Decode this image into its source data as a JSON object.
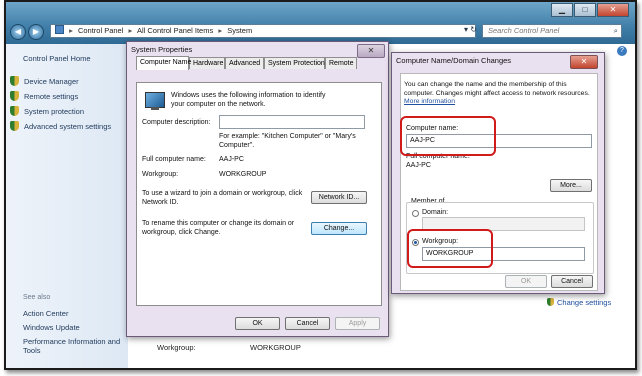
{
  "window": {
    "controls": {
      "minimize": "▁",
      "maximize": "□",
      "close": "✕"
    },
    "address": {
      "root_icon": "control-panel-icon",
      "crumbs": [
        "Control Panel",
        "All Control Panel Items",
        "System"
      ]
    },
    "search_placeholder": "Search Control Panel"
  },
  "sidebar": {
    "home": "Control Panel Home",
    "items": [
      "Device Manager",
      "Remote settings",
      "System protection",
      "Advanced system settings"
    ],
    "see_also": "See also",
    "links": [
      "Action Center",
      "Windows Update",
      "Performance Information and Tools"
    ]
  },
  "main": {
    "workgroup_label": "Workgroup:",
    "workgroup_value": "WORKGROUP",
    "change_settings": "Change settings"
  },
  "system_properties": {
    "title": "System Properties",
    "close": "✕",
    "tabs": [
      "Computer Name",
      "Hardware",
      "Advanced",
      "System Protection",
      "Remote"
    ],
    "intro": "Windows uses the following information to identify your computer on the network.",
    "desc_label": "Computer description:",
    "desc_value": "",
    "example": "For example: \"Kitchen Computer\" or \"Mary's Computer\".",
    "full_name_label": "Full computer name:",
    "full_name_value": "AAJ-PC",
    "workgroup_label": "Workgroup:",
    "workgroup_value": "WORKGROUP",
    "wizard_text": "To use a wizard to join a domain or workgroup, click Network ID.",
    "network_id_button": "Network ID...",
    "rename_text": "To rename this computer or change its domain or workgroup, click Change.",
    "change_button": "Change...",
    "ok": "OK",
    "cancel": "Cancel",
    "apply": "Apply"
  },
  "name_changes": {
    "title": "Computer Name/Domain Changes",
    "close": "✕",
    "intro": "You can change the name and the membership of this computer. Changes might affect access to network resources.",
    "more_info": "More information",
    "computer_name_label": "Computer name:",
    "computer_name_value": "AAJ-PC",
    "full_name_label": "Full computer name:",
    "full_name_value": "AAJ-PC",
    "more_button": "More...",
    "member_of": "Member of",
    "domain_label": "Domain:",
    "domain_value": "",
    "workgroup_label": "Workgroup:",
    "workgroup_value": "WORKGROUP",
    "ok": "OK",
    "cancel": "Cancel"
  },
  "colors": {
    "highlight": "#d11a1a",
    "link": "#1f4fa0"
  }
}
